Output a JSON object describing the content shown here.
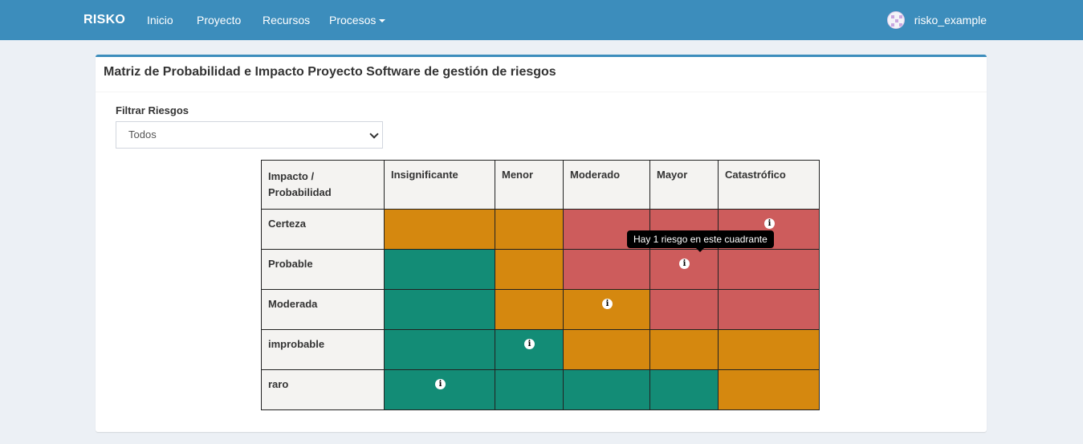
{
  "navbar": {
    "brand": "RISKO",
    "items": [
      {
        "label": "Inicio"
      },
      {
        "label": "Proyecto"
      },
      {
        "label": "Recursos"
      },
      {
        "label": "Procesos"
      }
    ],
    "user": "risko_example"
  },
  "page": {
    "title": "Matriz de Probabilidad e Impacto Proyecto Software de gestión de riesgos",
    "filter_label": "Filtrar Riesgos",
    "filter_value": "Todos"
  },
  "matrix": {
    "corner_header": "Impacto / Probabilidad",
    "columns": [
      "Insignificante",
      "Menor",
      "Moderado",
      "Mayor",
      "Catastrófico"
    ],
    "rows": [
      "Certeza",
      "Probable",
      "Moderada",
      "improbable",
      "raro"
    ],
    "colors": {
      "green": "#138c76",
      "orange": "#d5880f",
      "red": "#cd5c5c"
    },
    "cell_levels": [
      [
        "orange",
        "orange",
        "red",
        "red",
        "red"
      ],
      [
        "green",
        "orange",
        "red",
        "red",
        "red"
      ],
      [
        "green",
        "orange",
        "orange",
        "red",
        "red"
      ],
      [
        "green",
        "green",
        "orange",
        "orange",
        "orange"
      ],
      [
        "green",
        "green",
        "green",
        "green",
        "orange"
      ]
    ],
    "risk_markers": [
      {
        "row": 0,
        "col": 4,
        "icon": "info-icon"
      },
      {
        "row": 1,
        "col": 3,
        "icon": "info-icon"
      },
      {
        "row": 2,
        "col": 2,
        "icon": "info-icon"
      },
      {
        "row": 3,
        "col": 1,
        "icon": "info-icon"
      },
      {
        "row": 4,
        "col": 0,
        "icon": "info-icon"
      }
    ],
    "tooltip": "Hay 1 riesgo en este cuadrante"
  }
}
